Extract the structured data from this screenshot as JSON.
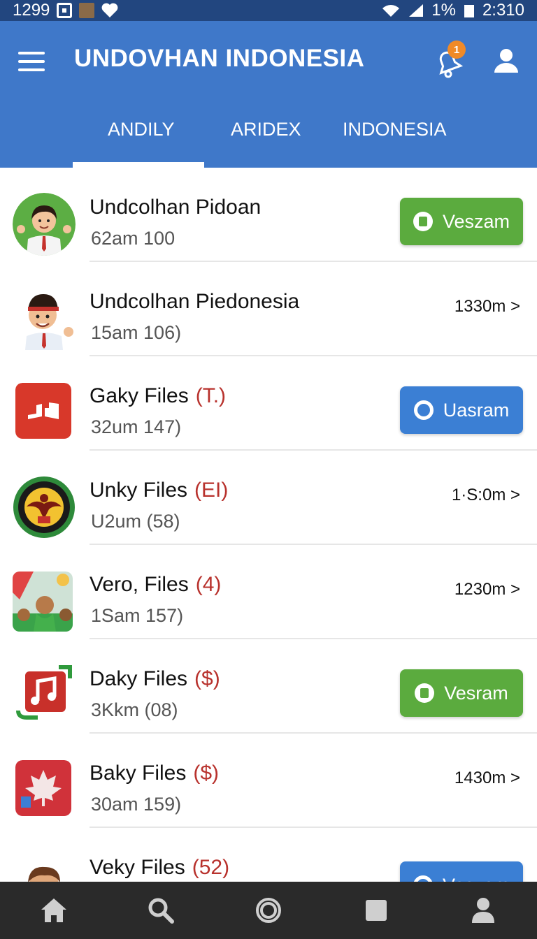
{
  "status_bar": {
    "left_text": "1299",
    "right_text": "1%",
    "time": "2:310"
  },
  "app": {
    "title": "UNDOVHAN INDONESIA",
    "notification_count": "1"
  },
  "tabs": [
    {
      "label": "ANDILY",
      "active": true
    },
    {
      "label": "ARIDEX",
      "active": false
    },
    {
      "label": "INDONESIA",
      "active": false
    }
  ],
  "items": [
    {
      "title": "Undcolhan Pidoan",
      "tag": "",
      "subtitle": "62am 100",
      "action": "button",
      "action_label": "Veszam",
      "action_color": "green",
      "icon": "teacher-avatar-icon"
    },
    {
      "title": "Undcolhan Piedonesia",
      "tag": "",
      "subtitle": "15am 106)",
      "action": "meta",
      "action_label": "1330m >",
      "icon": "boy-avatar-icon"
    },
    {
      "title": "Gaky Files",
      "tag": "(T.)",
      "subtitle": "32um 147)",
      "action": "button",
      "action_label": "Uasram",
      "action_color": "blue",
      "icon": "red-book-app-icon"
    },
    {
      "title": "Unky Files",
      "tag": "(EI)",
      "subtitle": "U2um (58)",
      "action": "meta",
      "action_label": "1·S:0m >",
      "icon": "garuda-emblem-icon"
    },
    {
      "title": "Vero, Files",
      "tag": "(4)",
      "subtitle": "1Sam 157)",
      "action": "meta",
      "action_label": "1230m >",
      "icon": "crowd-photo-icon"
    },
    {
      "title": "Daky Files",
      "tag": "($)",
      "subtitle": "3Kkm (08)",
      "action": "button",
      "action_label": "Vesram",
      "action_color": "green",
      "icon": "music-note-app-icon"
    },
    {
      "title": "Baky Files",
      "tag": "($)",
      "subtitle": "30am 159)",
      "action": "meta",
      "action_label": "1430m >",
      "icon": "maple-leaf-app-icon"
    },
    {
      "title": "Veky Files",
      "tag": "(52)",
      "subtitle": "",
      "action": "button",
      "action_label": "Veszam",
      "action_color": "blue",
      "icon": "man-avatar-icon"
    }
  ],
  "bottom_nav": [
    {
      "name": "home-icon"
    },
    {
      "name": "search-icon"
    },
    {
      "name": "circle-icon"
    },
    {
      "name": "square-icon"
    },
    {
      "name": "person-icon"
    }
  ],
  "colors": {
    "primary": "#3f78c9",
    "status_bar": "#22467f",
    "green_button": "#5bab3e",
    "blue_button": "#3b7fd4",
    "tag_red": "#b8322d",
    "nav_bg": "#2a2a2a"
  }
}
